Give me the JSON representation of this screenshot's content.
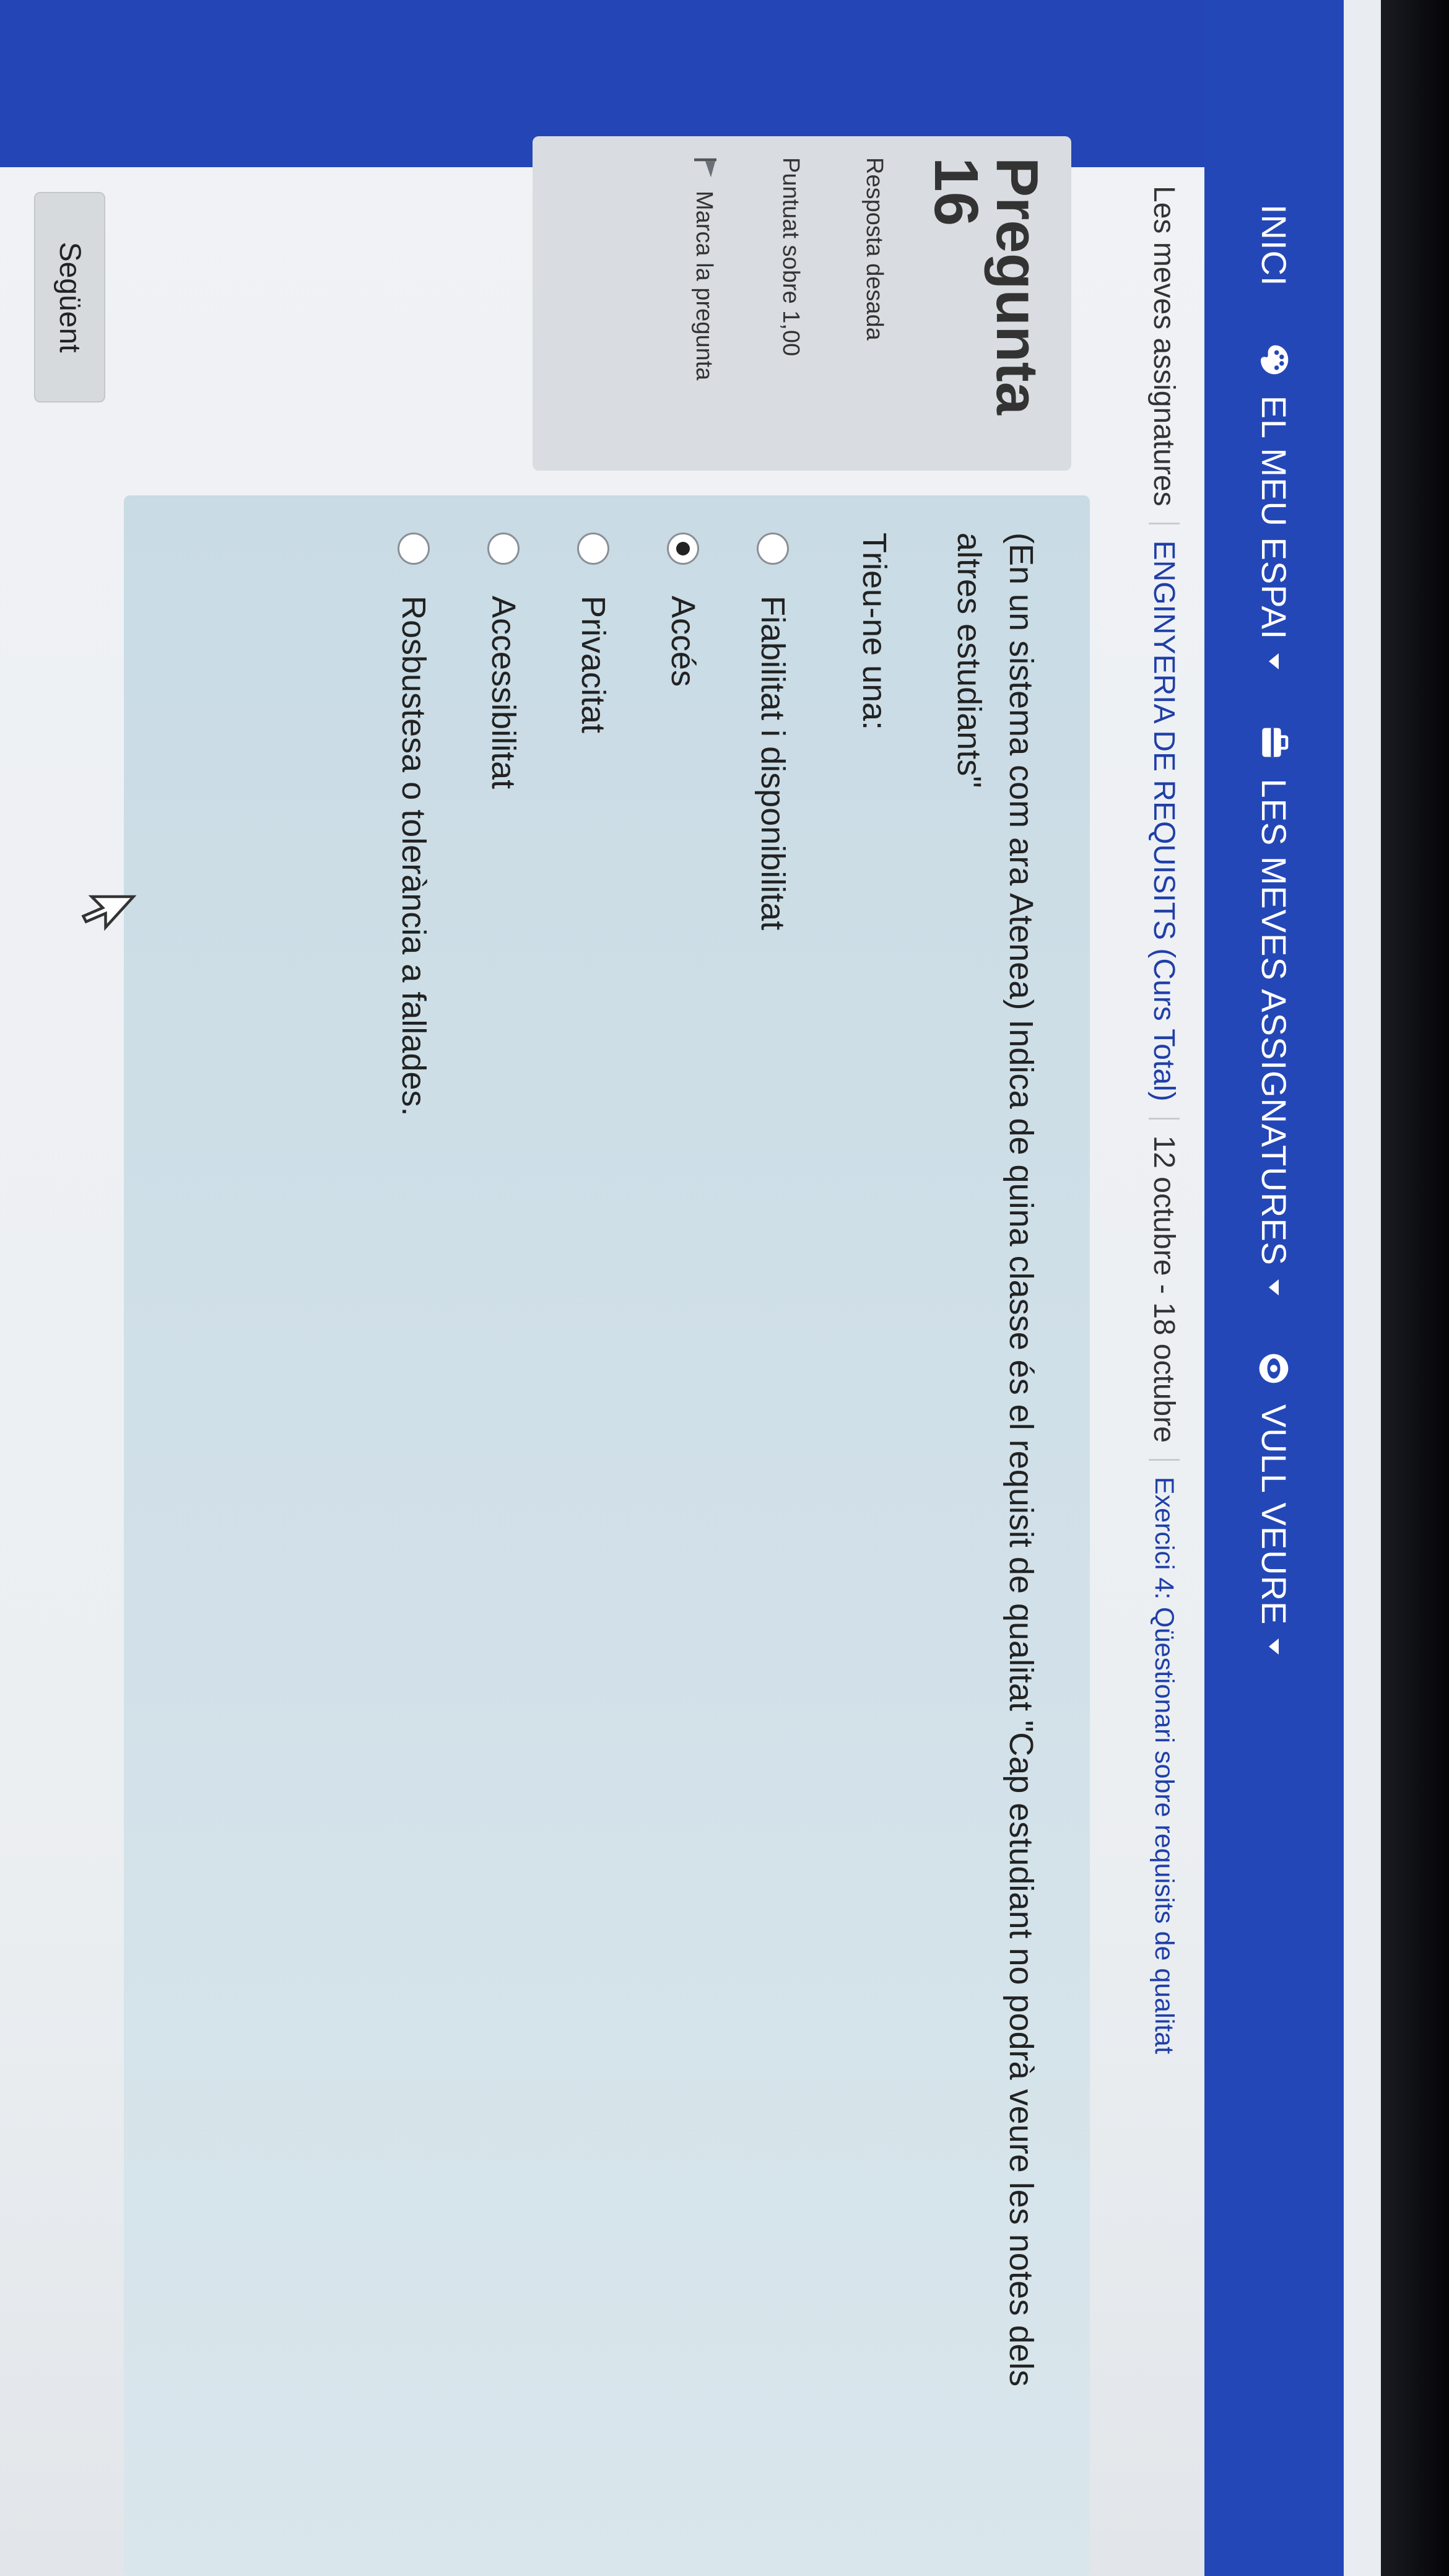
{
  "navbar": {
    "items": [
      {
        "label": "INICI",
        "icon": null
      },
      {
        "label": "EL MEU ESPAI",
        "icon": "palette-icon",
        "dropdown": true
      },
      {
        "label": "LES MEVES ASSIGNATURES",
        "icon": "briefcase-icon",
        "dropdown": true
      },
      {
        "label": "VULL VEURE",
        "icon": "eye-icon",
        "dropdown": true
      }
    ],
    "background": "#2447b8"
  },
  "breadcrumb": [
    "Les meves assignatures",
    "ENGINYERIA DE REQUISITS (Curs Total)",
    "12 octubre - 18 octubre",
    "Exercici 4: Qüestionari sobre requisits de qualitat"
  ],
  "question_info": {
    "title": "Pregunta",
    "number": "16",
    "status": "Resposta desada",
    "grade": "Puntuat sobre 1,00",
    "flag_label": "Marca la pregunta"
  },
  "question": {
    "text": "(En un sistema com ara Atenea) Indica de quina classe és el requisit de qualitat \"Cap estudiant no podrà veure les notes dels altres estudiants\"",
    "prompt": "Trieu-ne una:",
    "options": [
      {
        "label": "Fiabilitat i disponibilitat",
        "selected": false
      },
      {
        "label": "Accés",
        "selected": true
      },
      {
        "label": "Privacitat",
        "selected": false
      },
      {
        "label": "Accessibilitat",
        "selected": false
      },
      {
        "label": "Rosbustesa o tolerància a fallades.",
        "selected": false
      }
    ]
  },
  "next_button": {
    "label": "Següent"
  },
  "colors": {
    "accent": "#2447b8",
    "link": "#1f3fa8",
    "panel": "#d2e1e9",
    "info_box": "#d9dde1"
  }
}
